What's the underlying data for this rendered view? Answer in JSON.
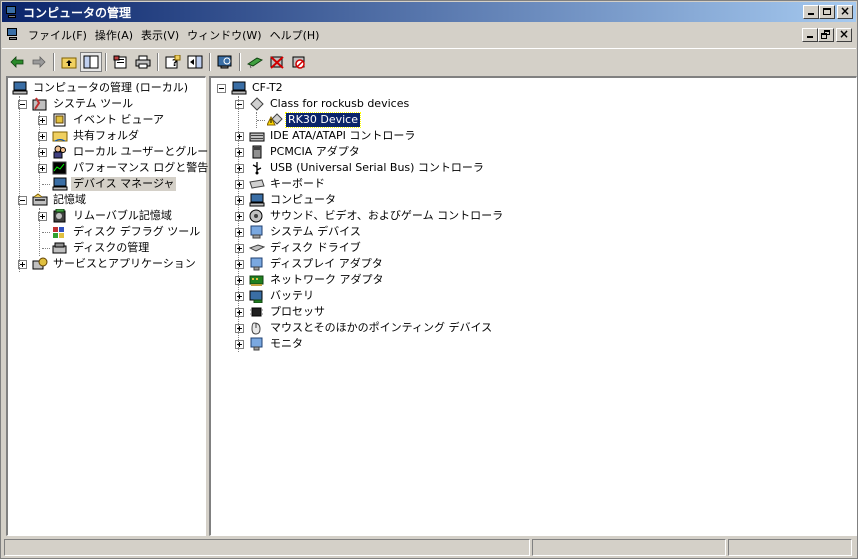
{
  "window": {
    "title": "コンピュータの管理",
    "icon": "computer-management-icon"
  },
  "menubar": {
    "items": [
      "ファイル(F)",
      "操作(A)",
      "表示(V)",
      "ウィンドウ(W)",
      "ヘルプ(H)"
    ]
  },
  "toolbar": {
    "buttons": [
      "back-arrow-icon",
      "forward-arrow-icon",
      "up-folder-icon",
      "show-hide-tree-icon",
      "properties-icon",
      "print-icon",
      "help-icon",
      "action-pane-icon",
      "scan-hardware-icon",
      "update-driver-icon",
      "uninstall-icon",
      "disable-icon"
    ]
  },
  "left_tree": [
    {
      "label": "コンピュータの管理 (ローカル)",
      "level": 0,
      "expander": "none",
      "icon": "computer-icon"
    },
    {
      "label": "システム ツール",
      "level": 1,
      "expander": "minus",
      "icon": "tools-icon"
    },
    {
      "label": "イベント ビューア",
      "level": 2,
      "expander": "plus",
      "icon": "event-viewer-icon"
    },
    {
      "label": "共有フォルダ",
      "level": 2,
      "expander": "plus",
      "icon": "shared-folder-icon"
    },
    {
      "label": "ローカル ユーザーとグループ",
      "level": 2,
      "expander": "plus",
      "icon": "users-icon"
    },
    {
      "label": "パフォーマンス ログと警告",
      "level": 2,
      "expander": "plus",
      "icon": "performance-icon"
    },
    {
      "label": "デバイス マネージャ",
      "level": 2,
      "expander": "none",
      "icon": "device-manager-icon",
      "selected": true
    },
    {
      "label": "記憶域",
      "level": 1,
      "expander": "minus",
      "icon": "storage-icon"
    },
    {
      "label": "リムーバブル記憶域",
      "level": 2,
      "expander": "plus",
      "icon": "removable-storage-icon"
    },
    {
      "label": "ディスク デフラグ ツール",
      "level": 2,
      "expander": "none",
      "icon": "defrag-icon"
    },
    {
      "label": "ディスクの管理",
      "level": 2,
      "expander": "none",
      "icon": "disk-management-icon"
    },
    {
      "label": "サービスとアプリケーション",
      "level": 1,
      "expander": "plus",
      "icon": "services-icon"
    }
  ],
  "right_tree": [
    {
      "label": "CF-T2",
      "level": 0,
      "expander": "minus",
      "icon": "computer-icon"
    },
    {
      "label": "Class for rockusb devices",
      "level": 1,
      "expander": "minus",
      "icon": "device-class-icon"
    },
    {
      "label": "RK30 Device",
      "level": 2,
      "expander": "none",
      "icon": "warning-device-icon",
      "selected": true
    },
    {
      "label": "IDE ATA/ATAPI コントローラ",
      "level": 1,
      "expander": "plus",
      "icon": "ide-controller-icon"
    },
    {
      "label": "PCMCIA アダプタ",
      "level": 1,
      "expander": "plus",
      "icon": "pcmcia-icon"
    },
    {
      "label": "USB (Universal Serial Bus) コントローラ",
      "level": 1,
      "expander": "plus",
      "icon": "usb-icon"
    },
    {
      "label": "キーボード",
      "level": 1,
      "expander": "plus",
      "icon": "keyboard-icon"
    },
    {
      "label": "コンピュータ",
      "level": 1,
      "expander": "plus",
      "icon": "computer-icon"
    },
    {
      "label": "サウンド、ビデオ、およびゲーム コントローラ",
      "level": 1,
      "expander": "plus",
      "icon": "sound-icon"
    },
    {
      "label": "システム デバイス",
      "level": 1,
      "expander": "plus",
      "icon": "system-device-icon"
    },
    {
      "label": "ディスク ドライブ",
      "level": 1,
      "expander": "plus",
      "icon": "disk-drive-icon"
    },
    {
      "label": "ディスプレイ アダプタ",
      "level": 1,
      "expander": "plus",
      "icon": "display-adapter-icon"
    },
    {
      "label": "ネットワーク アダプタ",
      "level": 1,
      "expander": "plus",
      "icon": "network-adapter-icon"
    },
    {
      "label": "バッテリ",
      "level": 1,
      "expander": "plus",
      "icon": "battery-icon"
    },
    {
      "label": "プロセッサ",
      "level": 1,
      "expander": "plus",
      "icon": "processor-icon"
    },
    {
      "label": "マウスとそのほかのポインティング デバイス",
      "level": 1,
      "expander": "plus",
      "icon": "mouse-icon"
    },
    {
      "label": "モニタ",
      "level": 1,
      "expander": "plus",
      "icon": "monitor-icon"
    }
  ]
}
